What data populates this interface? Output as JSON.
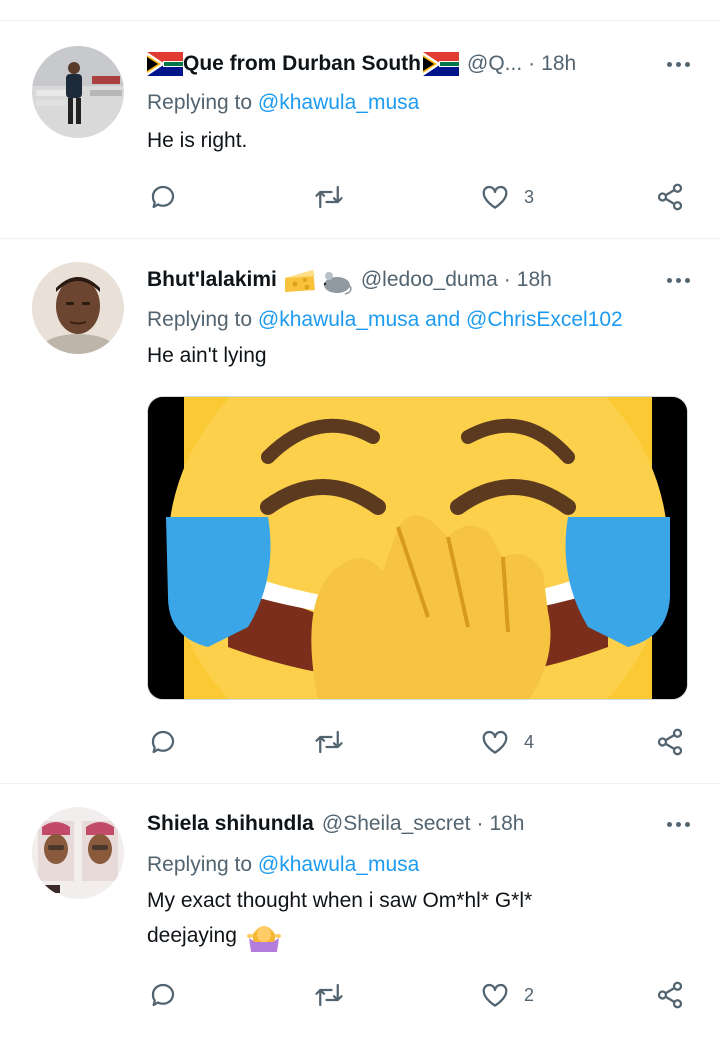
{
  "tweets": [
    {
      "name": "Que from Durban South",
      "handle": "@Q...",
      "time": "18h",
      "reply_prefix": "Replying to",
      "mentions": "@khawula_musa",
      "text": "He is right.",
      "reply_count": "",
      "retweet_count": "",
      "like_count": "3"
    },
    {
      "name": "Bhut'lalakimi",
      "handle": "@ledoo_duma",
      "time": "18h",
      "reply_prefix": "Replying to",
      "mentions": "@khawula_musa and @ChrisExcel102",
      "text": "He ain't lying",
      "reply_count": "",
      "retweet_count": "",
      "like_count": "4"
    },
    {
      "name": "Shiela shihundla",
      "handle": "@Sheila_secret",
      "time": "18h",
      "reply_prefix": "Replying to",
      "mentions": "@khawula_musa",
      "text": "My exact thought when i saw Om*hl*  G*l* deejaying",
      "reply_count": "",
      "retweet_count": "",
      "like_count": "2"
    }
  ],
  "dot": "·",
  "icons": {
    "reply": "reply-icon",
    "retweet": "retweet-icon",
    "like": "heart-icon",
    "share": "share-icon",
    "more": "more-icon",
    "flag": "south-africa-flag-icon",
    "cheese": "cheese-emoji",
    "mouse": "mouse-emoji",
    "shrug": "shrugging-woman-emoji",
    "media": "laughing-face-emoji-image"
  },
  "colors": {
    "link": "#1d9bf0",
    "secondary_text": "#536471",
    "primary_text": "#0f1419",
    "divider": "#eff3f4",
    "emoji_yellow": "#fbc934",
    "tears": "#3aa6e8"
  }
}
